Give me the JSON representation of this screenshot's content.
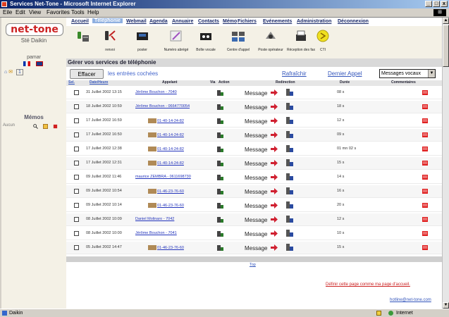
{
  "window": {
    "title": "Services Net-Tone - Microsoft Internet Explorer",
    "btn_min": "_",
    "btn_max": "□",
    "btn_close": "x"
  },
  "menubar": {
    "items": [
      "Eile",
      "Edit",
      "View",
      "Favorites",
      "Tools",
      "Help"
    ]
  },
  "sidebar": {
    "logo": "net-tone",
    "site": "Sté Daikin",
    "user": "pamar",
    "lang_select": "1",
    "memos_title": "Mémos",
    "memos_label": "Aucun"
  },
  "nav": {
    "items": [
      "Accueil",
      "Téléphonie",
      "Webmail",
      "Agenda",
      "Annuaire",
      "Contacts",
      "Mémo",
      "Fichiers",
      "Evénements",
      "Administration",
      "Déconnexion"
    ]
  },
  "toolbar": {
    "items": [
      {
        "label": "",
        "icon": "phone-icon"
      },
      {
        "label": "renvoi",
        "icon": "forward-icon"
      },
      {
        "label": "poster",
        "icon": "poster-icon"
      },
      {
        "label": "Numéro abrégé",
        "icon": "speed-dial-icon"
      },
      {
        "label": "Boîte vocale",
        "icon": "voicemail-icon"
      },
      {
        "label": "Centre d'appel",
        "icon": "call-center-icon"
      },
      {
        "label": "Poste opérateur",
        "icon": "operator-icon"
      },
      {
        "label": "Réception des fax",
        "icon": "fax-icon"
      },
      {
        "label": "CTI",
        "icon": "cti-icon"
      }
    ]
  },
  "section": {
    "title": "Gérer vos services de téléphonie"
  },
  "actions": {
    "delete_btn": "Effacer",
    "delete_label": "les entrées cochées",
    "refresh": "Rafraîchir",
    "last_call": "Dernier Appel",
    "select_value": "Messages vocaux"
  },
  "table": {
    "headers": [
      "Sel.",
      "Date/Heure",
      "Appelant",
      "Via",
      "Action",
      "Redirection",
      "Durée",
      "Commentaires"
    ],
    "rows": [
      {
        "date": "31 Juillet 2002 13:15",
        "caller": "Jérôme Bouchon - 7040",
        "redirection": "Message",
        "duration": "08 s"
      },
      {
        "date": "18 Juillet 2002 10:59",
        "caller": "Jérôme Bouchon - 0664770054",
        "redirection": "Message",
        "duration": "18 s"
      },
      {
        "date": "17 Juillet 2002 16:59",
        "caller": "01-40-14-24-82",
        "redirection": "Message",
        "duration": "12 s"
      },
      {
        "date": "17 Juillet 2002 16:50",
        "caller": "01-40-14-24-82",
        "redirection": "Message",
        "duration": "09 s"
      },
      {
        "date": "17 Juillet 2002 12:38",
        "caller": "01-40-14-24-82",
        "redirection": "Message",
        "duration": "01 mn 02 s"
      },
      {
        "date": "17 Juillet 2002 12:31",
        "caller": "01-40-14-24-82",
        "redirection": "Message",
        "duration": "15 s"
      },
      {
        "date": "09 Juillet 2002 11:46",
        "caller": "maurice ZEMBRA - 0611698730",
        "redirection": "Message",
        "duration": "14 s"
      },
      {
        "date": "09 Juillet 2002 10:54",
        "caller": "01-46-23-76-60",
        "redirection": "Message",
        "duration": "16 s"
      },
      {
        "date": "09 Juillet 2002 10:14",
        "caller": "01-46-23-76-60",
        "redirection": "Message",
        "duration": "20 s"
      },
      {
        "date": "08 Juillet 2002 10:09",
        "caller": "Daniel Molinaro - 7042",
        "redirection": "Message",
        "duration": "12 s"
      },
      {
        "date": "08 Juillet 2002 10:00",
        "caller": "Jérôme Bouchon - 7041",
        "redirection": "Message",
        "duration": "10 s"
      },
      {
        "date": "05 Juillet 2002 14:47",
        "caller": "01-46-23-76-60",
        "redirection": "Message",
        "duration": "15 s"
      }
    ]
  },
  "footer": {
    "top": "Top",
    "home_link": "Définir cette page comme ma page d'accueil.",
    "email": "hotline@net-tone.com"
  },
  "status": {
    "left": "Daikin",
    "zone": "Internet"
  }
}
